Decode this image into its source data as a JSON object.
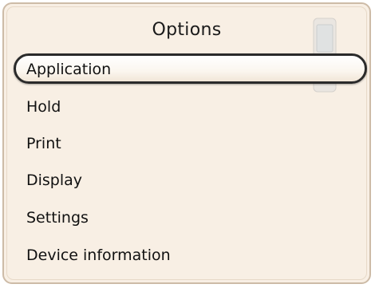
{
  "menu": {
    "title": "Options",
    "items": [
      {
        "label": "Application",
        "selected": true
      },
      {
        "label": "Hold",
        "selected": false
      },
      {
        "label": "Print",
        "selected": false
      },
      {
        "label": "Display",
        "selected": false
      },
      {
        "label": "Settings",
        "selected": false
      },
      {
        "label": "Device information",
        "selected": false
      }
    ]
  },
  "colors": {
    "background": "#f8efe4",
    "border": "#cdbba7",
    "selection_border": "#2a2a2a"
  },
  "icons": {
    "header_graphic": "handheld-device-icon"
  }
}
